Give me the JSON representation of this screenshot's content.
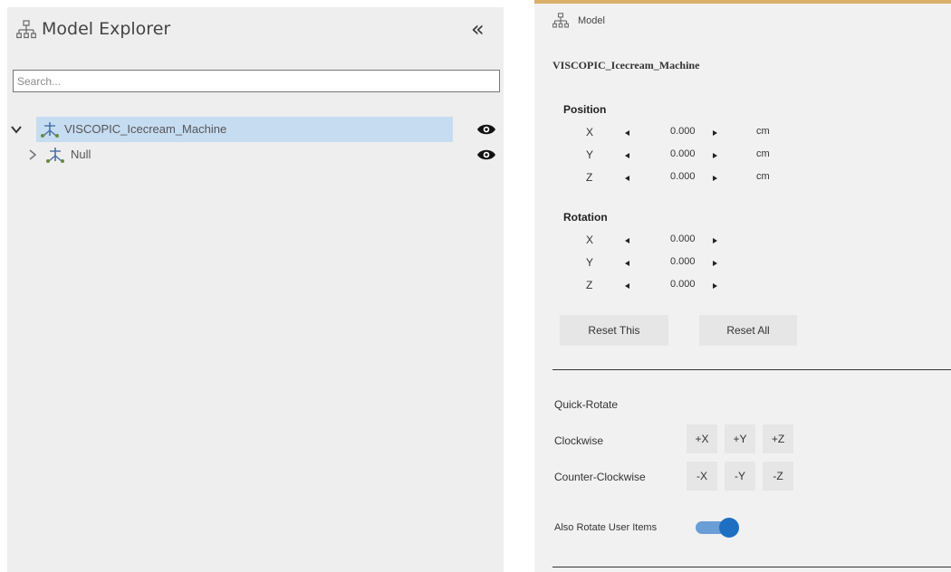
{
  "explorer": {
    "title": "Model Explorer",
    "collapse_label": "«",
    "search_placeholder": "Search...",
    "tree": [
      {
        "label": "VISCOPIC_Icecream_Machine",
        "expanded": true,
        "selected": true,
        "visible": true
      },
      {
        "label": "Null",
        "expanded": false,
        "selected": false,
        "visible": true
      }
    ],
    "icons": {
      "title": "hierarchy-icon",
      "collapse": "double-chevron-left-icon",
      "expand": "chevron-down-icon",
      "collapsed": "chevron-right-icon",
      "node": "model-node-icon",
      "visibility": "eye-icon"
    },
    "colors": {
      "selection": "#c6dcf1",
      "panel": "#eeeeee"
    }
  },
  "model_panel": {
    "title": "Model",
    "model_name": "VISCOPIC_Icecream_Machine",
    "position": {
      "heading": "Position",
      "rows": [
        {
          "axis": "X",
          "value": "0.000",
          "unit": "cm"
        },
        {
          "axis": "Y",
          "value": "0.000",
          "unit": "cm"
        },
        {
          "axis": "Z",
          "value": "0.000",
          "unit": "cm"
        }
      ]
    },
    "rotation": {
      "heading": "Rotation",
      "rows": [
        {
          "axis": "X",
          "value": "0.000"
        },
        {
          "axis": "Y",
          "value": "0.000"
        },
        {
          "axis": "Z",
          "value": "0.000"
        }
      ]
    },
    "reset_this_label": "Reset This",
    "reset_all_label": "Reset All",
    "quick_rotate": {
      "heading": "Quick-Rotate",
      "clockwise_label": "Clockwise",
      "clockwise_buttons": [
        "+X",
        "+Y",
        "+Z"
      ],
      "counter_label": "Counter-Clockwise",
      "counter_buttons": [
        "-X",
        "-Y",
        "-Z"
      ]
    },
    "also_rotate_label": "Also Rotate User Items",
    "also_rotate_on": true,
    "colors": {
      "accent_top": "#d9b06a",
      "toggle": "#1e6fc2",
      "panel": "#f1f1f1"
    }
  }
}
